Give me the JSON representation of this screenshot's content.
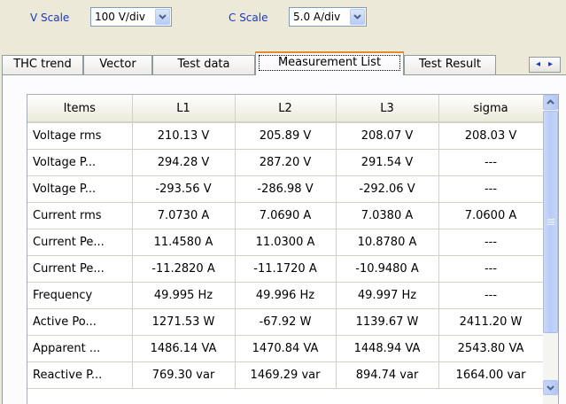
{
  "toolbar": {
    "v_scale_label": "V Scale",
    "v_scale_value": "100 V/div",
    "c_scale_label": "C Scale",
    "c_scale_value": "5.0 A/div"
  },
  "tabs": [
    {
      "label": "THC trend",
      "active": false
    },
    {
      "label": "Vector",
      "active": false
    },
    {
      "label": "Test data",
      "active": false
    },
    {
      "label": "Measurement List",
      "active": true
    },
    {
      "label": "Test Result",
      "active": false
    }
  ],
  "table": {
    "headers": [
      "Items",
      "L1",
      "L2",
      "L3",
      "sigma"
    ],
    "rows": [
      [
        "Voltage rms",
        "210.13 V",
        "205.89 V",
        "208.07 V",
        "208.03 V"
      ],
      [
        "Voltage P...",
        "294.28 V",
        "287.20 V",
        "291.54 V",
        "---"
      ],
      [
        "Voltage P...",
        "-293.56 V",
        "-286.98 V",
        "-292.06 V",
        "---"
      ],
      [
        "Current rms",
        "7.0730 A",
        "7.0690 A",
        "7.0380 A",
        "7.0600 A"
      ],
      [
        "Current Pe...",
        "11.4580 A",
        "11.0300 A",
        "10.8780 A",
        "---"
      ],
      [
        "Current Pe...",
        "-11.2820 A",
        "-11.1720 A",
        "-10.9480 A",
        "---"
      ],
      [
        "Frequency",
        "49.995 Hz",
        "49.996 Hz",
        "49.997 Hz",
        "---"
      ],
      [
        "Active Po...",
        "1271.53 W",
        "-67.92 W",
        "1139.67 W",
        "2411.20 W"
      ],
      [
        "Apparent ...",
        "1486.14 VA",
        "1470.84 VA",
        "1448.94 VA",
        "2543.80 VA"
      ],
      [
        "Reactive P...",
        "769.30 var",
        "1469.29 var",
        "894.74 var",
        "1664.00 var"
      ]
    ]
  },
  "colors": {
    "accent_label": "#1a37c9",
    "active_tab_border": "#e68b2c",
    "window_bg": "#ece9d8"
  }
}
